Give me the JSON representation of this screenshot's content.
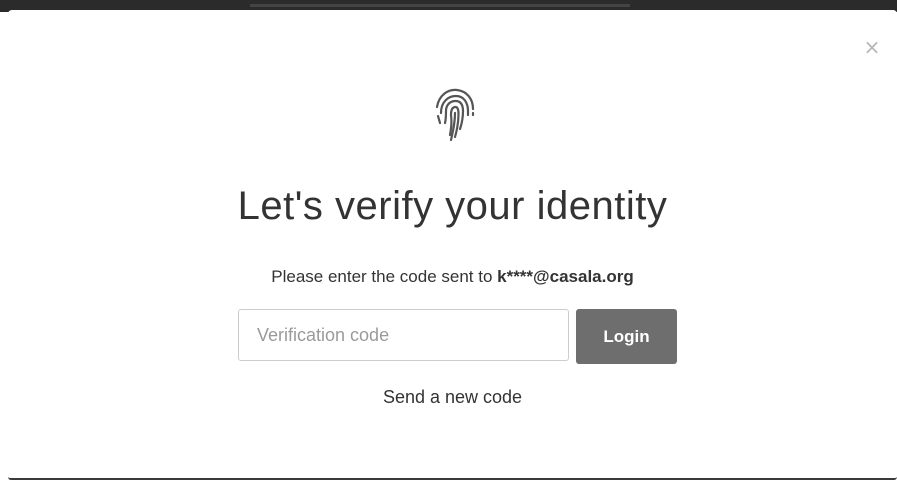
{
  "modal": {
    "close_glyph": "×",
    "icon": "fingerprint-icon",
    "title": "Let's verify your identity",
    "subtitle_prefix": "Please enter the code sent to ",
    "email_masked": "k****@casala.org",
    "input": {
      "placeholder": "Verification code",
      "value": ""
    },
    "login_label": "Login",
    "resend_label": "Send a new code"
  },
  "colors": {
    "button_bg": "#6e6e6e",
    "text": "#333333",
    "placeholder": "#9a9a9a",
    "close": "#b5b5b5"
  }
}
